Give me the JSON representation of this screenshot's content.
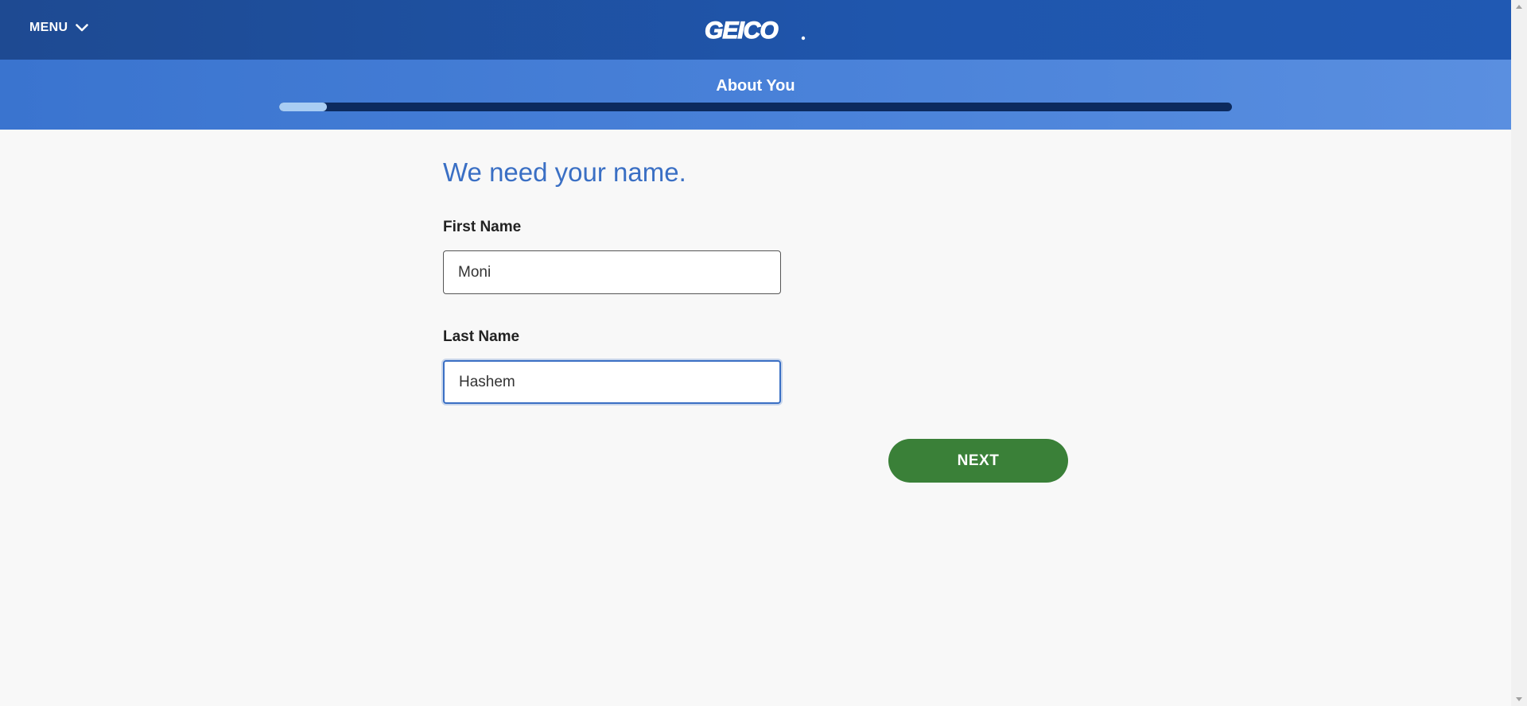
{
  "header": {
    "menu_label": "MENU",
    "logo_text": "GEICO",
    "brand_color": "#1f56ad"
  },
  "progress": {
    "step_title": "About You",
    "completion_fraction": 0.05
  },
  "form": {
    "heading": "We need your name.",
    "first_name": {
      "label": "First Name",
      "value": "Moni"
    },
    "last_name": {
      "label": "Last Name",
      "value": "Hashem"
    },
    "next_label": "NEXT",
    "next_color": "#3a8038"
  },
  "icons": {
    "menu_chevron": "chevron-down-icon",
    "scroll_up": "scroll-up-arrow-icon",
    "scroll_down": "scroll-down-arrow-icon"
  }
}
